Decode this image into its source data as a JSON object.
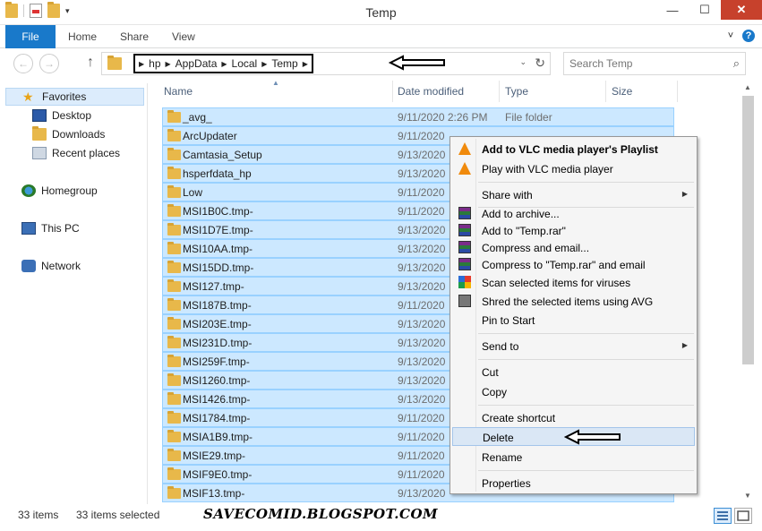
{
  "window": {
    "title": "Temp",
    "minimize": "—",
    "maximize": "☐",
    "close": "✕"
  },
  "ribbon": {
    "tabs": [
      "File",
      "Home",
      "Share",
      "View"
    ],
    "expand_icon": "˅",
    "help_icon": "?"
  },
  "navigation": {
    "back_icon": "←",
    "forward_icon": "→",
    "up_icon": "↑",
    "breadcrumbs": [
      "hp",
      "AppData",
      "Local",
      "Temp"
    ],
    "dropdown_icon": "⌄",
    "refresh_icon": "↻",
    "search_placeholder": "Search Temp"
  },
  "sidebar": {
    "favorites": "Favorites",
    "desktop": "Desktop",
    "downloads": "Downloads",
    "recent_places": "Recent places",
    "homegroup": "Homegroup",
    "this_pc": "This PC",
    "network": "Network"
  },
  "columns": {
    "name": "Name",
    "date": "Date modified",
    "type": "Type",
    "size": "Size"
  },
  "files": [
    {
      "name": "_avg_",
      "date": "9/11/2020 2:26 PM",
      "type": "File folder"
    },
    {
      "name": "ArcUpdater",
      "date": "9/11/2020 ",
      "type": ""
    },
    {
      "name": "Camtasia_Setup",
      "date": "9/13/2020 ",
      "type": ""
    },
    {
      "name": "hsperfdata_hp",
      "date": "9/13/2020 ",
      "type": ""
    },
    {
      "name": "Low",
      "date": "9/11/2020 ",
      "type": ""
    },
    {
      "name": "MSI1B0C.tmp-",
      "date": "9/11/2020 ",
      "type": ""
    },
    {
      "name": "MSI1D7E.tmp-",
      "date": "9/13/2020 ",
      "type": ""
    },
    {
      "name": "MSI10AA.tmp-",
      "date": "9/13/2020 ",
      "type": ""
    },
    {
      "name": "MSI15DD.tmp-",
      "date": "9/13/2020 ",
      "type": ""
    },
    {
      "name": "MSI127.tmp-",
      "date": "9/13/2020 ",
      "type": ""
    },
    {
      "name": "MSI187B.tmp-",
      "date": "9/11/2020 ",
      "type": ""
    },
    {
      "name": "MSI203E.tmp-",
      "date": "9/13/2020 ",
      "type": ""
    },
    {
      "name": "MSI231D.tmp-",
      "date": "9/13/2020 ",
      "type": ""
    },
    {
      "name": "MSI259F.tmp-",
      "date": "9/13/2020 ",
      "type": ""
    },
    {
      "name": "MSI1260.tmp-",
      "date": "9/13/2020 ",
      "type": ""
    },
    {
      "name": "MSI1426.tmp-",
      "date": "9/13/2020 ",
      "type": ""
    },
    {
      "name": "MSI1784.tmp-",
      "date": "9/11/2020 ",
      "type": ""
    },
    {
      "name": "MSIA1B9.tmp-",
      "date": "9/11/2020 ",
      "type": ""
    },
    {
      "name": "MSIE29.tmp-",
      "date": "9/11/2020 ",
      "type": ""
    },
    {
      "name": "MSIF9E0.tmp-",
      "date": "9/11/2020 ",
      "type": ""
    },
    {
      "name": "MSIF13.tmp-",
      "date": "9/13/2020 ",
      "type": ""
    }
  ],
  "context_menu": {
    "add_vlc_playlist": "Add to VLC media player's Playlist",
    "play_vlc": "Play with VLC media player",
    "share_with": "Share with",
    "add_to_archive": "Add to archive...",
    "add_to_rar": "Add to \"Temp.rar\"",
    "compress_email": "Compress and email...",
    "compress_rar_email": "Compress to \"Temp.rar\" and email",
    "scan_viruses": "Scan selected items for viruses",
    "shred_avg": "Shred the selected items using AVG",
    "pin_start": "Pin to Start",
    "send_to": "Send to",
    "cut": "Cut",
    "copy": "Copy",
    "create_shortcut": "Create shortcut",
    "delete": "Delete",
    "rename": "Rename",
    "properties": "Properties",
    "submenu_icon": "▶"
  },
  "status": {
    "items": "33 items",
    "selected": "33 items selected",
    "watermark": "SAVECOMID.BLOGSPOT.COM"
  },
  "colors": {
    "selection": "#cce8ff",
    "accent": "#1979ca",
    "close": "#c7412c",
    "folder": "#e8b84a"
  }
}
